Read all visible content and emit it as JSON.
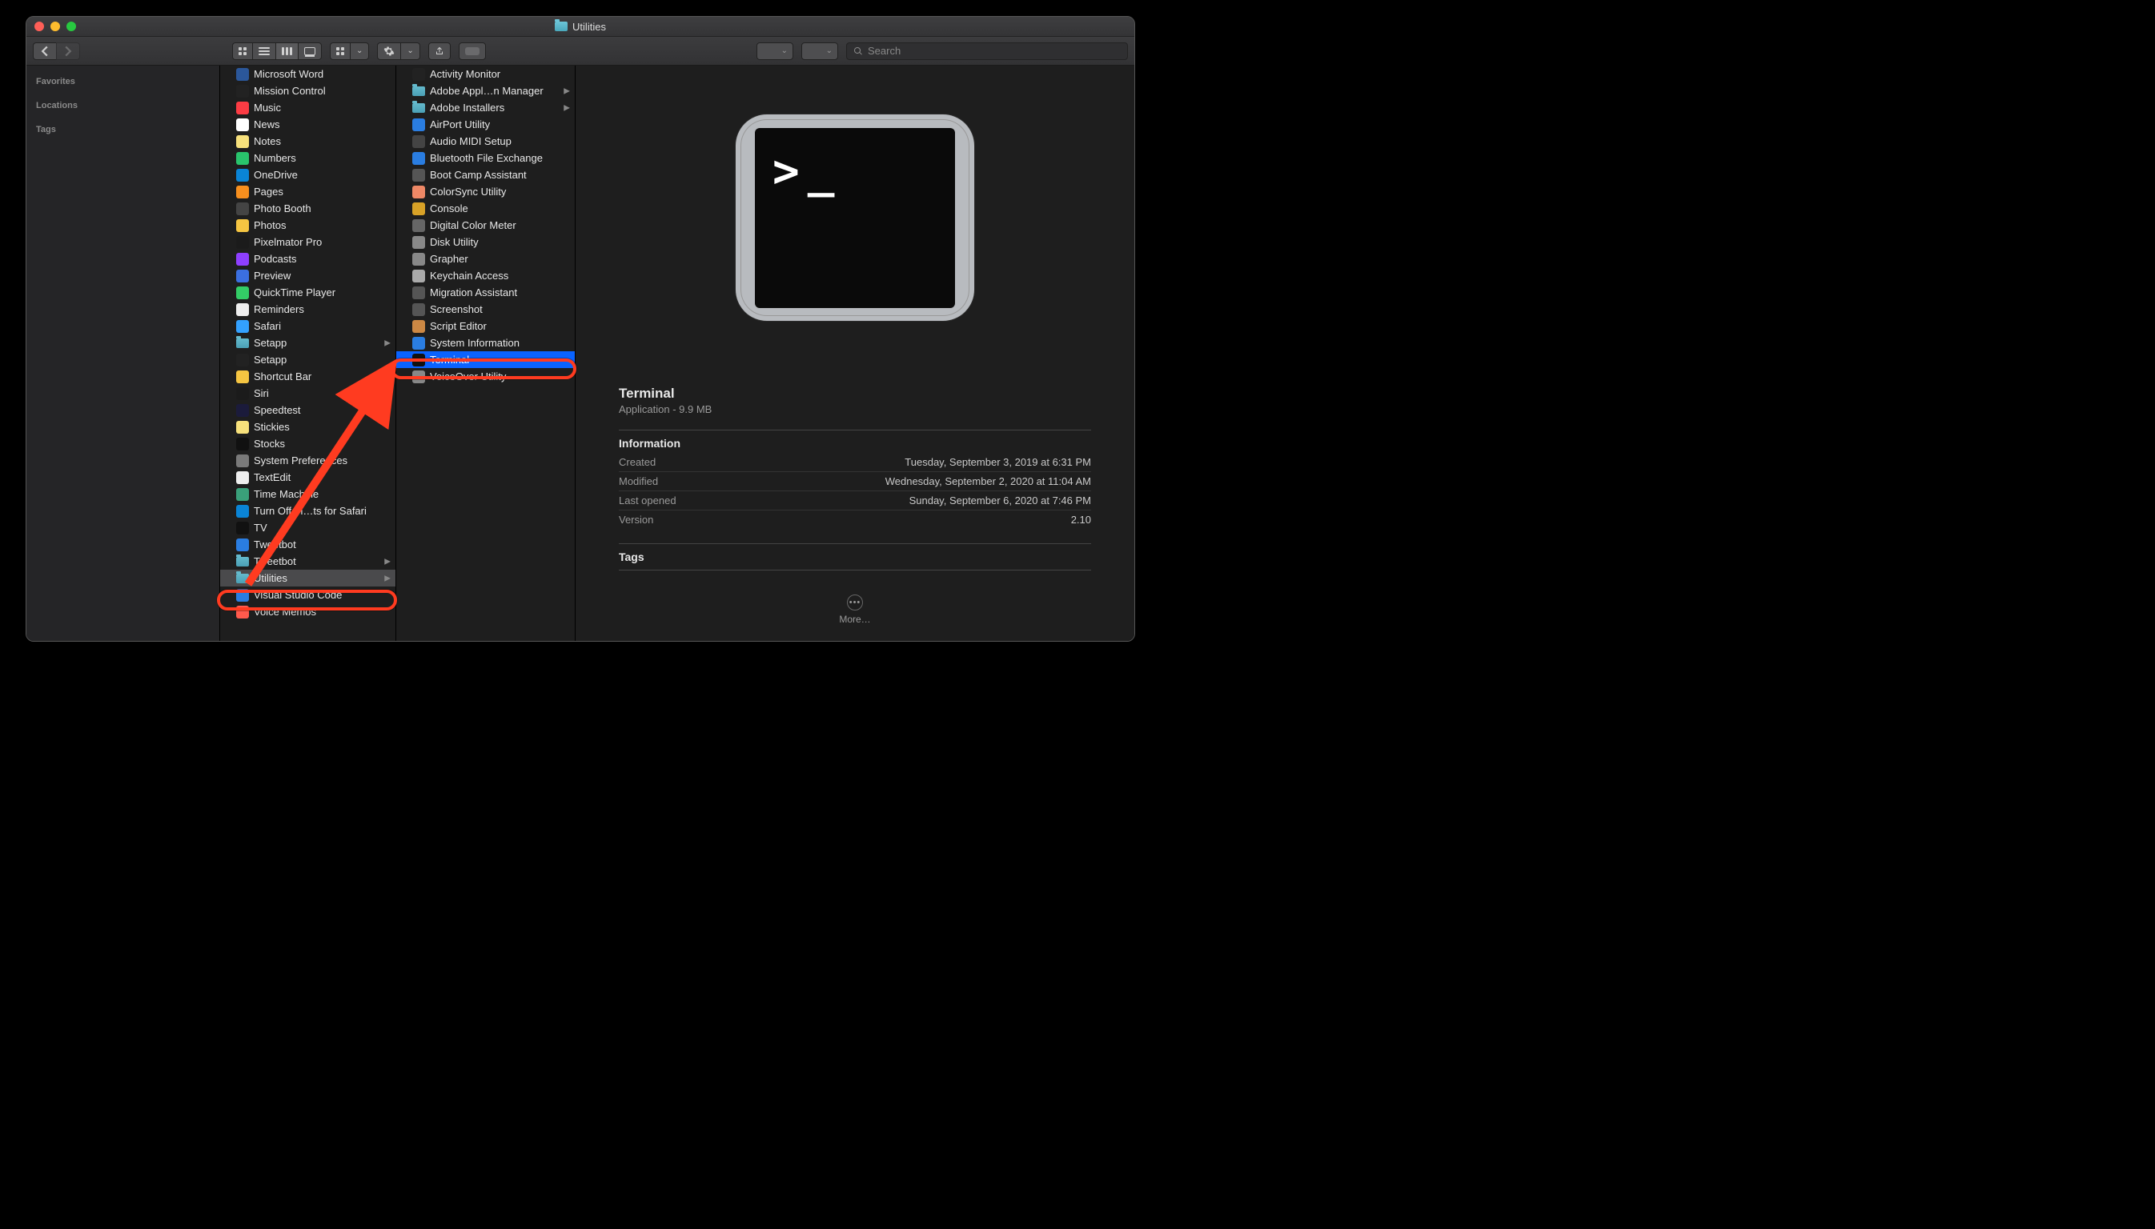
{
  "window": {
    "title": "Utilities"
  },
  "toolbar": {
    "search_placeholder": "Search"
  },
  "sidebar": {
    "sections": [
      "Favorites",
      "Locations",
      "Tags"
    ]
  },
  "col1": [
    {
      "label": "Microsoft Word",
      "kind": "app",
      "color": "#2b579a"
    },
    {
      "label": "Mission Control",
      "kind": "app",
      "color": "#222"
    },
    {
      "label": "Music",
      "kind": "app",
      "color": "#fc3c44"
    },
    {
      "label": "News",
      "kind": "app",
      "color": "#fff"
    },
    {
      "label": "Notes",
      "kind": "app",
      "color": "#f7e17c"
    },
    {
      "label": "Numbers",
      "kind": "app",
      "color": "#29c46c"
    },
    {
      "label": "OneDrive",
      "kind": "app",
      "color": "#0a84d6"
    },
    {
      "label": "Pages",
      "kind": "app",
      "color": "#f78f1e"
    },
    {
      "label": "Photo Booth",
      "kind": "app",
      "color": "#444"
    },
    {
      "label": "Photos",
      "kind": "app",
      "color": "#f5c542"
    },
    {
      "label": "Pixelmator Pro",
      "kind": "app",
      "color": "#1b1b1b"
    },
    {
      "label": "Podcasts",
      "kind": "app",
      "color": "#8e3fff"
    },
    {
      "label": "Preview",
      "kind": "app",
      "color": "#3b6fe0"
    },
    {
      "label": "QuickTime Player",
      "kind": "app",
      "color": "#3c6"
    },
    {
      "label": "Reminders",
      "kind": "app",
      "color": "#eee"
    },
    {
      "label": "Safari",
      "kind": "app",
      "color": "#33a1ff"
    },
    {
      "label": "Setapp",
      "kind": "folder",
      "hasChildren": true
    },
    {
      "label": "Setapp",
      "kind": "app",
      "color": "#222"
    },
    {
      "label": "Shortcut Bar",
      "kind": "app",
      "color": "#f5c542"
    },
    {
      "label": "Siri",
      "kind": "app",
      "color": "#1b1b1b"
    },
    {
      "label": "Speedtest",
      "kind": "app",
      "color": "#1b1b3b"
    },
    {
      "label": "Stickies",
      "kind": "app",
      "color": "#f7e17c"
    },
    {
      "label": "Stocks",
      "kind": "app",
      "color": "#111"
    },
    {
      "label": "System Preferences",
      "kind": "app",
      "color": "#7a7a7a"
    },
    {
      "label": "TextEdit",
      "kind": "app",
      "color": "#eee"
    },
    {
      "label": "Time Machine",
      "kind": "app",
      "color": "#3aa07a"
    },
    {
      "label": "Turn Off th…ts for Safari",
      "kind": "app",
      "color": "#0a84d6"
    },
    {
      "label": "TV",
      "kind": "app",
      "color": "#111"
    },
    {
      "label": "Tweetbot",
      "kind": "app",
      "color": "#2a7de1"
    },
    {
      "label": "Tweetbot",
      "kind": "folder",
      "hasChildren": true
    },
    {
      "label": "Utilities",
      "kind": "folder",
      "hasChildren": true,
      "active": true
    },
    {
      "label": "Visual Studio Code",
      "kind": "app",
      "color": "#2a7de1"
    },
    {
      "label": "Voice Memos",
      "kind": "app",
      "color": "#ff5a4d"
    }
  ],
  "col2": [
    {
      "label": "Activity Monitor",
      "kind": "app",
      "color": "#222"
    },
    {
      "label": "Adobe Appl…n Manager",
      "kind": "folder",
      "hasChildren": true
    },
    {
      "label": "Adobe Installers",
      "kind": "folder",
      "hasChildren": true
    },
    {
      "label": "AirPort Utility",
      "kind": "app",
      "color": "#2a7de1"
    },
    {
      "label": "Audio MIDI Setup",
      "kind": "app",
      "color": "#444"
    },
    {
      "label": "Bluetooth File Exchange",
      "kind": "app",
      "color": "#2a7de1"
    },
    {
      "label": "Boot Camp Assistant",
      "kind": "app",
      "color": "#555"
    },
    {
      "label": "ColorSync Utility",
      "kind": "app",
      "color": "#e86"
    },
    {
      "label": "Console",
      "kind": "app",
      "color": "#d8a227"
    },
    {
      "label": "Digital Color Meter",
      "kind": "app",
      "color": "#666"
    },
    {
      "label": "Disk Utility",
      "kind": "app",
      "color": "#888"
    },
    {
      "label": "Grapher",
      "kind": "app",
      "color": "#888"
    },
    {
      "label": "Keychain Access",
      "kind": "app",
      "color": "#aaa"
    },
    {
      "label": "Migration Assistant",
      "kind": "app",
      "color": "#555"
    },
    {
      "label": "Screenshot",
      "kind": "app",
      "color": "#555"
    },
    {
      "label": "Script Editor",
      "kind": "app",
      "color": "#c84"
    },
    {
      "label": "System Information",
      "kind": "app",
      "color": "#2a7de1"
    },
    {
      "label": "Terminal",
      "kind": "app",
      "color": "#111",
      "selected": true
    },
    {
      "label": "VoiceOver Utility",
      "kind": "app",
      "color": "#888"
    }
  ],
  "preview": {
    "name": "Terminal",
    "subtitle": "Application - 9.9 MB",
    "section_info": "Information",
    "rows": [
      {
        "k": "Created",
        "v": "Tuesday, September 3, 2019 at 6:31 PM"
      },
      {
        "k": "Modified",
        "v": "Wednesday, September 2, 2020 at 11:04 AM"
      },
      {
        "k": "Last opened",
        "v": "Sunday, September 6, 2020 at 7:46 PM"
      },
      {
        "k": "Version",
        "v": "2.10"
      }
    ],
    "section_tags": "Tags",
    "more": "More…"
  }
}
